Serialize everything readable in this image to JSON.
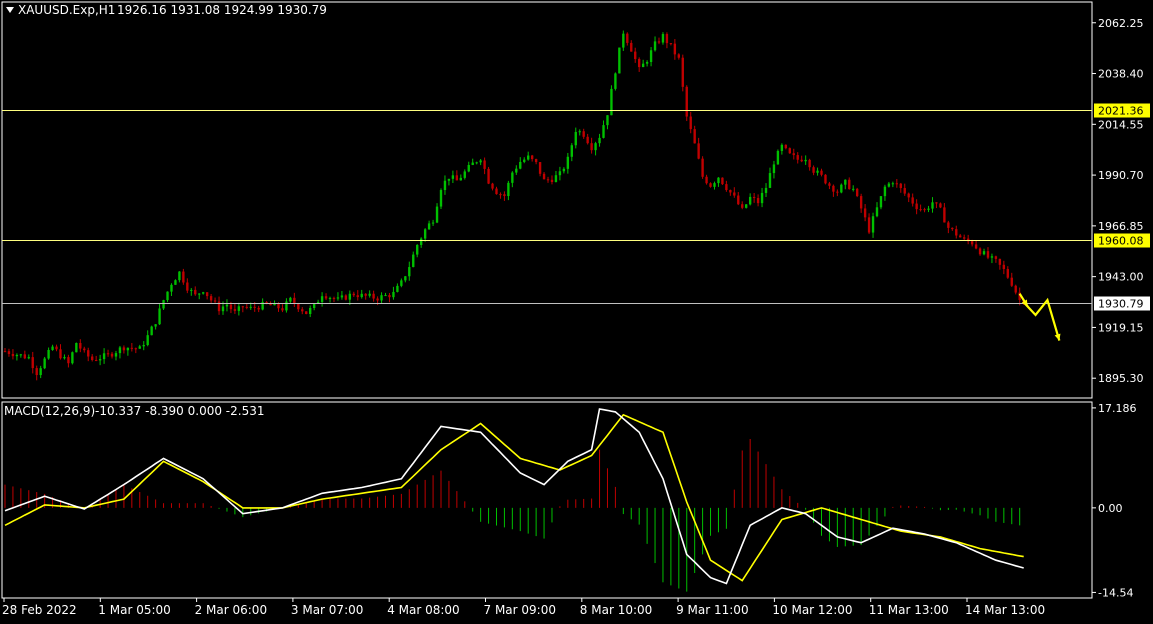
{
  "colors": {
    "background": "#000000",
    "frame": "#ffffff",
    "bull_candle": "#00c000",
    "bear_candle": "#c00000",
    "level_line": "#ffff80",
    "current_line": "#c0c0c0",
    "macd_line": "#ffffff",
    "signal_line": "#ffff00",
    "arrow": "#ffff00"
  },
  "header": {
    "symbol": "XAUUSD.Exp,H1",
    "ohlc": "1926.16 1931.08 1924.99 1930.79",
    "menu_icon": "triangle-down-icon"
  },
  "chart_data": [
    {
      "type": "candlestick",
      "title": "XAUUSD.Exp,H1",
      "ylim": [
        1886,
        2072
      ],
      "ytick_labels": [
        "2062.25",
        "2038.40",
        "2014.55",
        "1990.70",
        "1966.85",
        "1943.00",
        "1919.15",
        "1895.30"
      ],
      "xtick_labels": [
        "28 Feb 2022",
        "1 Mar 05:00",
        "2 Mar 06:00",
        "3 Mar 07:00",
        "4 Mar 08:00",
        "7 Mar 09:00",
        "8 Mar 10:00",
        "9 Mar 11:00",
        "10 Mar 12:00",
        "11 Mar 13:00",
        "14 Mar 13:00"
      ],
      "levels": [
        {
          "value": 2021.36,
          "label": "2021.36",
          "style": "horizontal-line"
        },
        {
          "value": 1960.08,
          "label": "1960.08",
          "style": "horizontal-line"
        },
        {
          "value": 1930.79,
          "label": "1930.79",
          "style": "current-price"
        }
      ],
      "close_path": [
        [
          0,
          1908
        ],
        [
          6,
          1905
        ],
        [
          8,
          1898
        ],
        [
          12,
          1910
        ],
        [
          16,
          1902
        ],
        [
          18,
          1912
        ],
        [
          20,
          1907
        ],
        [
          22,
          1904
        ],
        [
          26,
          1906
        ],
        [
          30,
          1910
        ],
        [
          34,
          1909
        ],
        [
          36,
          1915
        ],
        [
          38,
          1922
        ],
        [
          40,
          1932
        ],
        [
          42,
          1940
        ],
        [
          44,
          1945
        ],
        [
          46,
          1938
        ],
        [
          48,
          1934
        ],
        [
          50,
          1937
        ],
        [
          52,
          1932
        ],
        [
          54,
          1928
        ],
        [
          56,
          1930
        ],
        [
          58,
          1926
        ],
        [
          60,
          1929
        ],
        [
          62,
          1928
        ],
        [
          66,
          1930
        ],
        [
          70,
          1928
        ],
        [
          72,
          1932
        ],
        [
          76,
          1926
        ],
        [
          78,
          1929
        ],
        [
          80,
          1935
        ],
        [
          84,
          1932
        ],
        [
          88,
          1935
        ],
        [
          90,
          1934
        ],
        [
          94,
          1933
        ],
        [
          98,
          1935
        ],
        [
          100,
          1940
        ],
        [
          102,
          1948
        ],
        [
          104,
          1958
        ],
        [
          106,
          1965
        ],
        [
          108,
          1970
        ],
        [
          110,
          1985
        ],
        [
          112,
          1990
        ],
        [
          114,
          1988
        ],
        [
          116,
          1992
        ],
        [
          118,
          1996
        ],
        [
          120,
          1999
        ],
        [
          122,
          1988
        ],
        [
          124,
          1983
        ],
        [
          126,
          1981
        ],
        [
          128,
          1992
        ],
        [
          130,
          1997
        ],
        [
          132,
          1999
        ],
        [
          134,
          1996
        ],
        [
          136,
          1988
        ],
        [
          138,
          1989
        ],
        [
          140,
          1991
        ],
        [
          142,
          1998
        ],
        [
          144,
          2012
        ],
        [
          146,
          2010
        ],
        [
          148,
          2004
        ],
        [
          150,
          2009
        ],
        [
          152,
          2020
        ],
        [
          154,
          2040
        ],
        [
          156,
          2058
        ],
        [
          158,
          2050
        ],
        [
          160,
          2040
        ],
        [
          162,
          2045
        ],
        [
          164,
          2052
        ],
        [
          166,
          2056
        ],
        [
          168,
          2051
        ],
        [
          170,
          2045
        ],
        [
          172,
          2018
        ],
        [
          174,
          2005
        ],
        [
          176,
          1990
        ],
        [
          178,
          1986
        ],
        [
          180,
          1990
        ],
        [
          182,
          1985
        ],
        [
          184,
          1980
        ],
        [
          186,
          1974
        ],
        [
          188,
          1980
        ],
        [
          190,
          1978
        ],
        [
          192,
          1985
        ],
        [
          194,
          1997
        ],
        [
          196,
          2004
        ],
        [
          198,
          2000
        ],
        [
          200,
          1998
        ],
        [
          202,
          1999
        ],
        [
          204,
          1993
        ],
        [
          206,
          1990
        ],
        [
          208,
          1986
        ],
        [
          210,
          1983
        ],
        [
          212,
          1987
        ],
        [
          214,
          1984
        ],
        [
          216,
          1975
        ],
        [
          218,
          1965
        ],
        [
          220,
          1975
        ],
        [
          222,
          1985
        ],
        [
          224,
          1988
        ],
        [
          226,
          1984
        ],
        [
          228,
          1980
        ],
        [
          230,
          1976
        ],
        [
          232,
          1974
        ],
        [
          234,
          1978
        ],
        [
          236,
          1974
        ],
        [
          238,
          1966
        ],
        [
          240,
          1963
        ],
        [
          242,
          1960
        ],
        [
          244,
          1959
        ],
        [
          246,
          1955
        ],
        [
          248,
          1952
        ],
        [
          250,
          1950
        ],
        [
          252,
          1946
        ],
        [
          254,
          1940
        ],
        [
          256,
          1932
        ],
        [
          257,
          1930.79
        ]
      ],
      "projection_arrows": [
        [
          [
            257,
            1931
          ],
          [
            260,
            1925
          ],
          [
            263,
            1932
          ],
          [
            266,
            1913
          ]
        ],
        [
          [
            256,
            1935
          ],
          [
            258,
            1929
          ]
        ]
      ]
    },
    {
      "type": "line",
      "title": "MACD(12,26,9)",
      "header_values": "-10.337 -8.390 0.000 -2.531",
      "ylim": [
        -15.5,
        18.2
      ],
      "ytick_labels": [
        "17.186",
        "0.00",
        "-14.54"
      ],
      "series": [
        {
          "role": "macd",
          "points": [
            [
              0,
              -0.5
            ],
            [
              10,
              2
            ],
            [
              20,
              -0.2
            ],
            [
              30,
              4
            ],
            [
              40,
              8.5
            ],
            [
              50,
              5
            ],
            [
              60,
              -1
            ],
            [
              70,
              0
            ],
            [
              80,
              2.5
            ],
            [
              90,
              3.5
            ],
            [
              100,
              5
            ],
            [
              110,
              14
            ],
            [
              120,
              13
            ],
            [
              130,
              6
            ],
            [
              136,
              4
            ],
            [
              142,
              8
            ],
            [
              148,
              10
            ],
            [
              150,
              17
            ],
            [
              154,
              16.5
            ],
            [
              160,
              13
            ],
            [
              166,
              5
            ],
            [
              172,
              -8
            ],
            [
              178,
              -12
            ],
            [
              182,
              -13
            ],
            [
              188,
              -3
            ],
            [
              196,
              0
            ],
            [
              202,
              -1
            ],
            [
              210,
              -5
            ],
            [
              216,
              -6
            ],
            [
              224,
              -3.5
            ],
            [
              232,
              -4.5
            ],
            [
              240,
              -6
            ],
            [
              250,
              -9
            ],
            [
              257,
              -10.337
            ]
          ]
        },
        {
          "role": "signal",
          "points": [
            [
              0,
              -3
            ],
            [
              10,
              0.5
            ],
            [
              20,
              0
            ],
            [
              30,
              1.5
            ],
            [
              40,
              8
            ],
            [
              50,
              4.5
            ],
            [
              60,
              0
            ],
            [
              70,
              0
            ],
            [
              80,
              1.5
            ],
            [
              90,
              2.5
            ],
            [
              100,
              3.5
            ],
            [
              110,
              10
            ],
            [
              120,
              14.5
            ],
            [
              130,
              8.5
            ],
            [
              140,
              6.5
            ],
            [
              148,
              9
            ],
            [
              156,
              16
            ],
            [
              166,
              13
            ],
            [
              172,
              1
            ],
            [
              178,
              -9
            ],
            [
              186,
              -12.5
            ],
            [
              196,
              -2
            ],
            [
              206,
              0
            ],
            [
              216,
              -2
            ],
            [
              226,
              -4
            ],
            [
              236,
              -5
            ],
            [
              246,
              -7
            ],
            [
              257,
              -8.39
            ]
          ]
        }
      ]
    }
  ]
}
